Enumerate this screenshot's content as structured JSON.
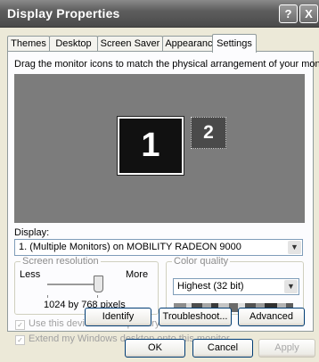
{
  "window": {
    "title": "Display Properties",
    "help_label": "?",
    "close_label": "X"
  },
  "tabs": [
    {
      "label": "Themes"
    },
    {
      "label": "Desktop"
    },
    {
      "label": "Screen Saver"
    },
    {
      "label": "Appearance"
    },
    {
      "label": "Settings",
      "active": true
    }
  ],
  "settings": {
    "instruction": "Drag the monitor icons to match the physical arrangement of your monitors.",
    "monitors": [
      {
        "label": "1",
        "selected": true
      },
      {
        "label": "2",
        "selected": false
      }
    ],
    "display_label": "Display:",
    "display_value": "1. (Multiple Monitors) on MOBILITY RADEON 9000",
    "screen_resolution": {
      "label": "Screen resolution",
      "less_label": "Less",
      "more_label": "More",
      "value_text": "1024 by 768 pixels",
      "slider_level": 1.0
    },
    "color_quality": {
      "label": "Color quality",
      "value": "Highest (32 bit)"
    },
    "checkboxes": [
      {
        "label": "Use this device as the primary monitor.",
        "checked": true,
        "enabled": false
      },
      {
        "label": "Extend my Windows desktop onto this monitor.",
        "checked": true,
        "enabled": false
      }
    ],
    "buttons": {
      "identify": "Identify",
      "troubleshoot": "Troubleshoot...",
      "advanced": "Advanced"
    }
  },
  "dialog_buttons": {
    "ok": "OK",
    "cancel": "Cancel",
    "apply": "Apply"
  },
  "colors": {
    "desktop_preview": "#7c7c7c",
    "title_bar": "#5e5e5e"
  }
}
